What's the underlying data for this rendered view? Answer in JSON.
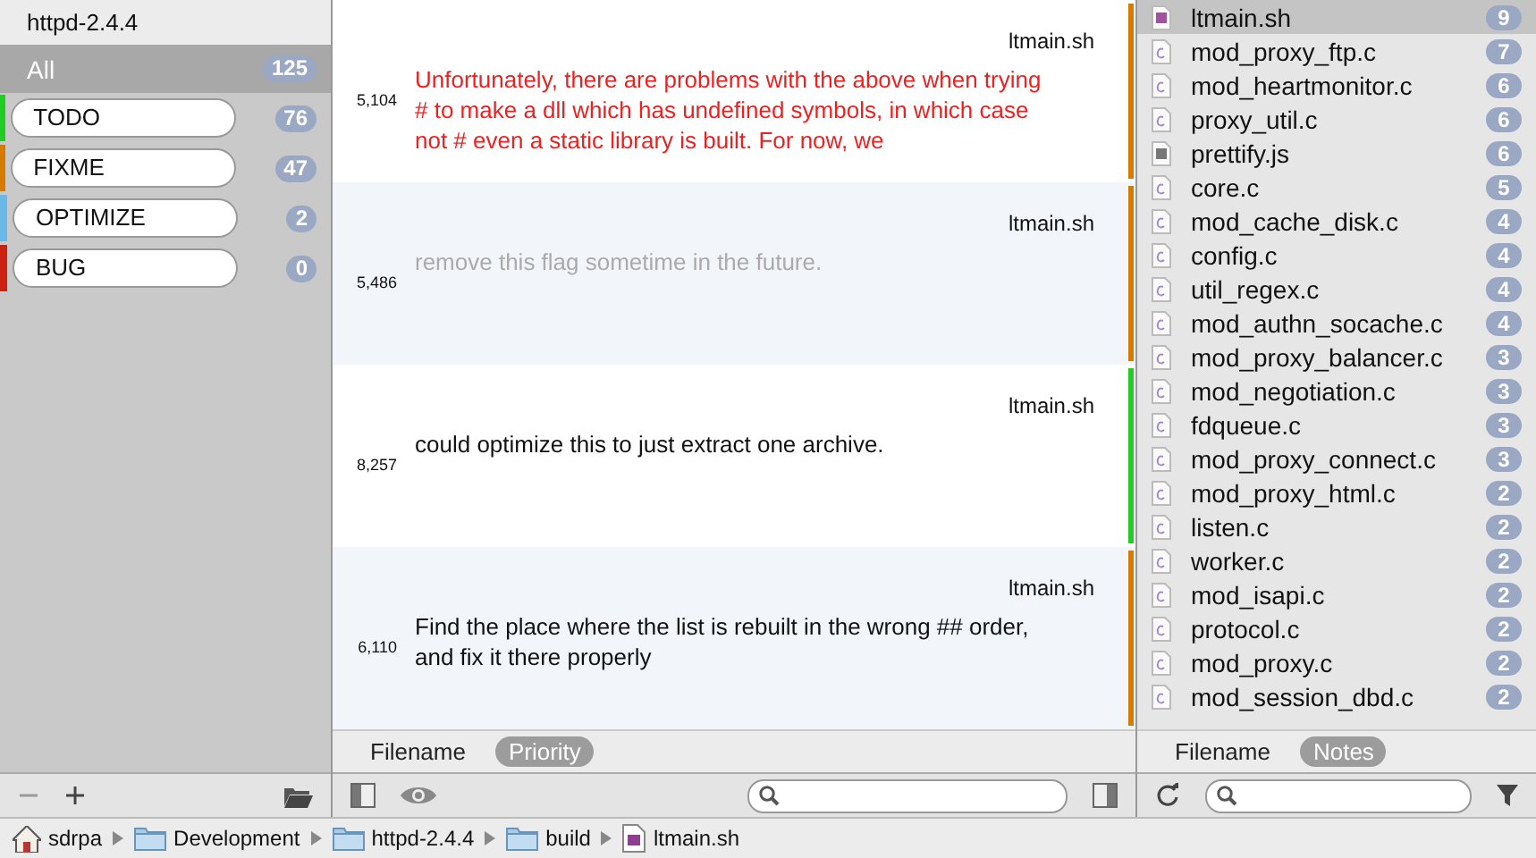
{
  "project": {
    "title": "httpd-2.4.4"
  },
  "categories": [
    {
      "label": "All",
      "count": "125",
      "selected": true
    },
    {
      "label": "TODO",
      "count": "76",
      "selected": false,
      "color": "#22cc22"
    },
    {
      "label": "FIXME",
      "count": "47",
      "selected": false,
      "color": "#d67a00"
    },
    {
      "label": "OPTIMIZE",
      "count": "2",
      "selected": false,
      "color": "#6ab8e6"
    },
    {
      "label": "BUG",
      "count": "0",
      "selected": false,
      "color": "#cc2211"
    }
  ],
  "notes": [
    {
      "line": "5,104",
      "file": "ltmain.sh",
      "text": "Unfortunately, there are problems with the above when trying # to make a dll which has undefined symbols, in which case not # even a static library is built. For now, we",
      "kind": "error",
      "color": "#d67a00"
    },
    {
      "line": "5,486",
      "file": "ltmain.sh",
      "text": "remove this flag sometime in the future.",
      "kind": "faded",
      "color": "#d67a00"
    },
    {
      "line": "8,257",
      "file": "ltmain.sh",
      "text": "could optimize this to just extract one archive.",
      "kind": "plain",
      "color": "#22cc22"
    },
    {
      "line": "6,110",
      "file": "ltmain.sh",
      "text": "Find the place where the list is rebuilt in the wrong ## order, and fix it there properly",
      "kind": "plain",
      "color": "#d67a00"
    }
  ],
  "notes_sort": [
    {
      "label": "Filename",
      "selected": false
    },
    {
      "label": "Priority",
      "selected": true
    }
  ],
  "files": [
    {
      "name": "ltmain.sh",
      "count": "9",
      "kind": "sh",
      "selected": true
    },
    {
      "name": "mod_proxy_ftp.c",
      "count": "7",
      "kind": "c",
      "selected": false
    },
    {
      "name": "mod_heartmonitor.c",
      "count": "6",
      "kind": "c",
      "selected": false
    },
    {
      "name": "proxy_util.c",
      "count": "6",
      "kind": "c",
      "selected": false
    },
    {
      "name": "prettify.js",
      "count": "6",
      "kind": "js",
      "selected": false
    },
    {
      "name": "core.c",
      "count": "5",
      "kind": "c",
      "selected": false
    },
    {
      "name": "mod_cache_disk.c",
      "count": "4",
      "kind": "c",
      "selected": false
    },
    {
      "name": "config.c",
      "count": "4",
      "kind": "c",
      "selected": false
    },
    {
      "name": "util_regex.c",
      "count": "4",
      "kind": "c",
      "selected": false
    },
    {
      "name": "mod_authn_socache.c",
      "count": "4",
      "kind": "c",
      "selected": false
    },
    {
      "name": "mod_proxy_balancer.c",
      "count": "3",
      "kind": "c",
      "selected": false
    },
    {
      "name": "mod_negotiation.c",
      "count": "3",
      "kind": "c",
      "selected": false
    },
    {
      "name": "fdqueue.c",
      "count": "3",
      "kind": "c",
      "selected": false
    },
    {
      "name": "mod_proxy_connect.c",
      "count": "3",
      "kind": "c",
      "selected": false
    },
    {
      "name": "mod_proxy_html.c",
      "count": "2",
      "kind": "c",
      "selected": false
    },
    {
      "name": "listen.c",
      "count": "2",
      "kind": "c",
      "selected": false
    },
    {
      "name": "worker.c",
      "count": "2",
      "kind": "c",
      "selected": false
    },
    {
      "name": "mod_isapi.c",
      "count": "2",
      "kind": "c",
      "selected": false
    },
    {
      "name": "protocol.c",
      "count": "2",
      "kind": "c",
      "selected": false
    },
    {
      "name": "mod_proxy.c",
      "count": "2",
      "kind": "c",
      "selected": false
    },
    {
      "name": "mod_session_dbd.c",
      "count": "2",
      "kind": "c",
      "selected": false
    }
  ],
  "files_sort": [
    {
      "label": "Filename",
      "selected": false
    },
    {
      "label": "Notes",
      "selected": true
    }
  ],
  "breadcrumb": [
    {
      "label": "sdrpa",
      "kind": "home"
    },
    {
      "label": "Development",
      "kind": "folder"
    },
    {
      "label": "httpd-2.4.4",
      "kind": "folder"
    },
    {
      "label": "build",
      "kind": "folder"
    },
    {
      "label": "ltmain.sh",
      "kind": "file"
    }
  ]
}
